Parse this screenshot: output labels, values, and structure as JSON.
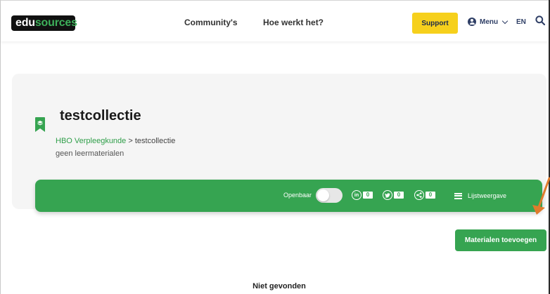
{
  "header": {
    "logo_part1": "edu",
    "logo_part2": "sources",
    "nav": [
      "Community's",
      "Hoe werkt het?"
    ],
    "support_label": "Support",
    "menu_label": "Menu",
    "language": "EN"
  },
  "collection": {
    "title": "testcollectie",
    "breadcrumb_parent": "HBO Verpleegkunde",
    "breadcrumb_separator": " > ",
    "breadcrumb_current": "testcollectie",
    "subtitle": "geen leermaterialen"
  },
  "toolbar": {
    "public_label": "Openbaar",
    "public_enabled": false,
    "shares": {
      "linkedin": "0",
      "twitter": "0",
      "share": "0"
    },
    "listview_label": "Lijstweergave"
  },
  "add_button_label": "Materialen toevoegen",
  "empty_message": "Niet gevonden",
  "colors": {
    "brand_green": "#36a451",
    "support_yellow": "#f6d01c",
    "annotation_arrow": "#e07b2c"
  }
}
